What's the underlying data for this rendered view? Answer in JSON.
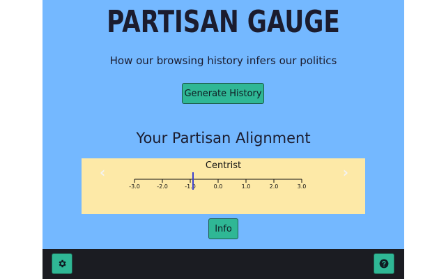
{
  "app": {
    "title": "PARTISAN GAUGE",
    "subtitle": "How our browsing history infers our politics"
  },
  "buttons": {
    "generate_label": "Generate History",
    "info_label": "Info"
  },
  "gauge": {
    "heading": "Your Partisan Alignment",
    "label": "Centrist",
    "ticks": [
      "-3.0",
      "-2.0",
      "-1.0",
      "0.0",
      "1.0",
      "2.0",
      "3.0"
    ],
    "range": [
      -3,
      3
    ],
    "value": -0.9,
    "marker_color": "#3b3fcf",
    "prev_icon": "chevron-left-icon",
    "next_icon": "chevron-right-icon"
  },
  "footer": {
    "settings_icon": "gear-icon",
    "help_icon": "question-circle-icon"
  }
}
